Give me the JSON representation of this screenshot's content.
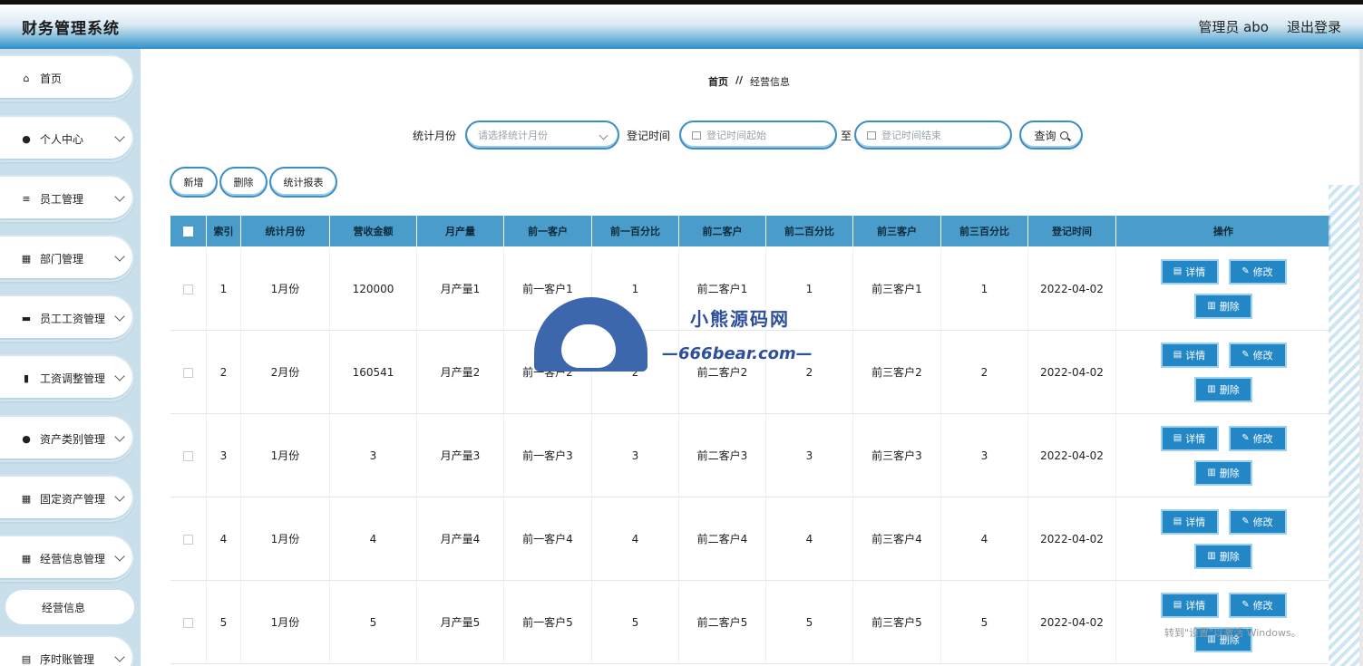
{
  "app": {
    "title": "财务管理系统"
  },
  "header": {
    "user_label": "管理员 abo",
    "logout_label": "退出登录"
  },
  "sidebar": {
    "items": [
      {
        "label": "首页",
        "icon": "home-icon",
        "glyph": "⌂",
        "has_children": false
      },
      {
        "label": "个人中心",
        "icon": "user-icon",
        "glyph": "●",
        "has_children": true
      },
      {
        "label": "员工管理",
        "icon": "list-icon",
        "glyph": "≡",
        "has_children": true
      },
      {
        "label": "部门管理",
        "icon": "grid-icon",
        "glyph": "▦",
        "has_children": true
      },
      {
        "label": "员工工资管理",
        "icon": "monitor-icon",
        "glyph": "▬",
        "has_children": true
      },
      {
        "label": "工资调整管理",
        "icon": "chart-icon",
        "glyph": "▮",
        "has_children": true
      },
      {
        "label": "资产类别管理",
        "icon": "user-icon",
        "glyph": "●",
        "has_children": true
      },
      {
        "label": "固定资产管理",
        "icon": "grid-icon",
        "glyph": "▦",
        "has_children": true
      },
      {
        "label": "经营信息管理",
        "icon": "grid-icon",
        "glyph": "▦",
        "has_children": true
      },
      {
        "label": "经营信息",
        "icon": "",
        "glyph": "",
        "has_children": false,
        "sub": true
      },
      {
        "label": "序时账管理",
        "icon": "doc-icon",
        "glyph": "▤",
        "has_children": true
      }
    ]
  },
  "breadcrumb": {
    "home": "首页",
    "sep": "//",
    "current": "经营信息"
  },
  "search": {
    "month_label": "统计月份",
    "month_placeholder": "请选择统计月份",
    "time_label": "登记时间",
    "time_start_placeholder": "登记时间起始",
    "to_label": "至",
    "time_end_placeholder": "登记时间结束",
    "query_label": "查询"
  },
  "actions": {
    "add": "新增",
    "delete": "删除",
    "report": "统计报表"
  },
  "table": {
    "headers": [
      "索引",
      "统计月份",
      "营收金额",
      "月产量",
      "前一客户",
      "前一百分比",
      "前二客户",
      "前二百分比",
      "前三客户",
      "前三百分比",
      "登记时间",
      "操作"
    ],
    "rows": [
      [
        "1",
        "1月份",
        "120000",
        "月产量1",
        "前一客户1",
        "1",
        "前二客户1",
        "1",
        "前三客户1",
        "1",
        "2022-04-02"
      ],
      [
        "2",
        "2月份",
        "160541",
        "月产量2",
        "前一客户2",
        "2",
        "前二客户2",
        "2",
        "前三客户2",
        "2",
        "2022-04-02"
      ],
      [
        "3",
        "1月份",
        "3",
        "月产量3",
        "前一客户3",
        "3",
        "前二客户3",
        "3",
        "前三客户3",
        "3",
        "2022-04-02"
      ],
      [
        "4",
        "1月份",
        "4",
        "月产量4",
        "前一客户4",
        "4",
        "前二客户4",
        "4",
        "前三客户4",
        "4",
        "2022-04-02"
      ],
      [
        "5",
        "1月份",
        "5",
        "月产量5",
        "前一客户5",
        "5",
        "前二客户5",
        "5",
        "前三客户5",
        "5",
        "2022-04-02"
      ]
    ],
    "op_detail": "详情",
    "op_edit": "修改",
    "op_delete": "删除"
  },
  "watermark": {
    "line1": "小熊源码网",
    "line2": "—666bear.com—"
  },
  "os_overlay": {
    "text": "转到\"设置\"以激活 Windows。"
  },
  "colors": {
    "accent": "#2387c5",
    "table_header": "#4a9ccb",
    "sidebar_bg": "#c9e0ec"
  }
}
